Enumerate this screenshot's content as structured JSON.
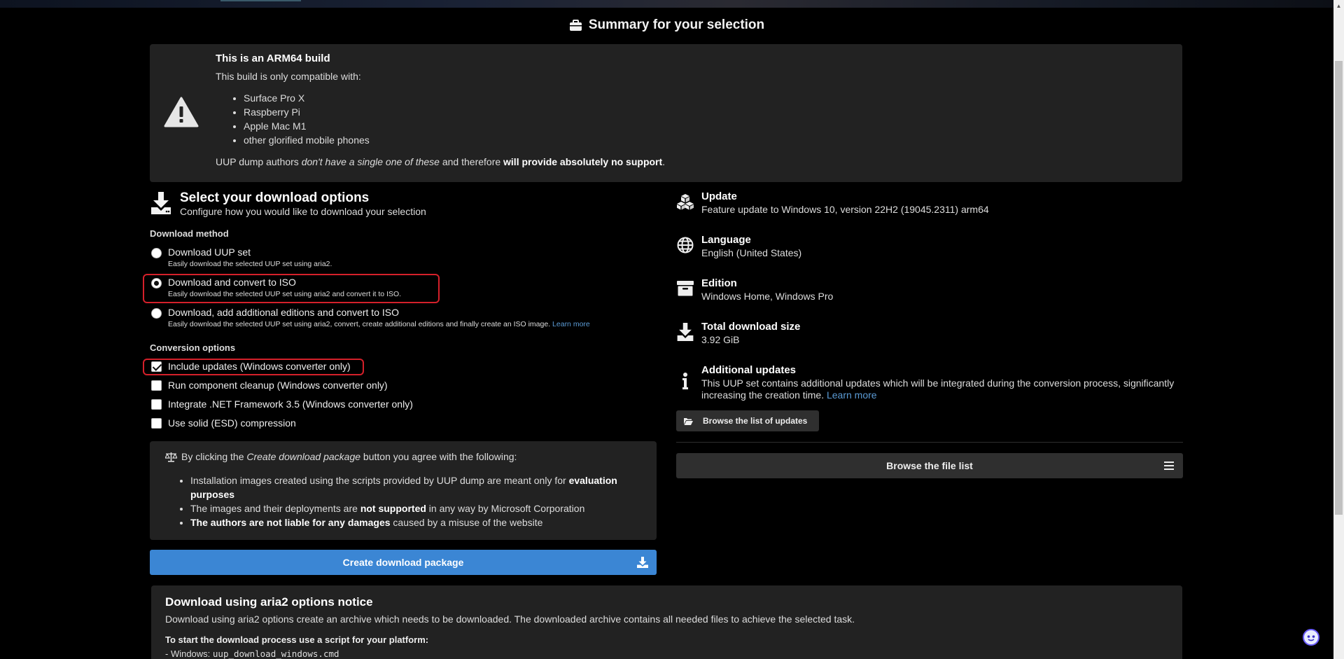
{
  "heading": "Summary for your selection",
  "warning": {
    "title": "This is an ARM64 build",
    "compat_label": "This build is only compatible with:",
    "devices": [
      "Surface Pro X",
      "Raspberry Pi",
      "Apple Mac M1",
      "other glorified mobile phones"
    ],
    "disclaimer_a": "UUP dump authors ",
    "disclaimer_b": "don't have a single one of these",
    "disclaimer_c": " and therefore ",
    "disclaimer_d": "will provide absolutely no support",
    "disclaimer_e": "."
  },
  "options": {
    "title": "Select your download options",
    "subtitle": "Configure how you would like to download your selection",
    "method_label": "Download method",
    "methods": [
      {
        "label": "Download UUP set",
        "desc": "Easily download the selected UUP set using aria2.",
        "checked": false
      },
      {
        "label": "Download and convert to ISO",
        "desc": "Easily download the selected UUP set using aria2 and convert it to ISO.",
        "checked": true
      },
      {
        "label": "Download, add additional editions and convert to ISO",
        "desc": "Easily download the selected UUP set using aria2, convert, create additional editions and finally create an ISO image.",
        "link": "Learn more",
        "checked": false
      }
    ],
    "conversion_label": "Conversion options",
    "conversions": [
      {
        "label": "Include updates (Windows converter only)",
        "checked": true
      },
      {
        "label": "Run component cleanup (Windows converter only)",
        "checked": false
      },
      {
        "label": "Integrate .NET Framework 3.5 (Windows converter only)",
        "checked": false
      },
      {
        "label": "Use solid (ESD) compression",
        "checked": false
      }
    ]
  },
  "agreement": {
    "lead_a": "By clicking the ",
    "lead_b": "Create download package",
    "lead_c": " button you agree with the following:",
    "items": [
      {
        "a": "Installation images created using the scripts provided by UUP dump are meant only for ",
        "b": "evaluation purposes",
        "c": ""
      },
      {
        "a": "The images and their deployments are ",
        "b": "not supported",
        "c": " in any way by Microsoft Corporation"
      },
      {
        "a": "",
        "b": "The authors are not liable for any damages",
        "c": " caused by a misuse of the website"
      }
    ]
  },
  "create_button": "Create download package",
  "summary": {
    "update": {
      "key": "Update",
      "value": "Feature update to Windows 10, version 22H2 (19045.2311) arm64"
    },
    "language": {
      "key": "Language",
      "value": "English (United States)"
    },
    "edition": {
      "key": "Edition",
      "value": "Windows Home, Windows Pro"
    },
    "size": {
      "key": "Total download size",
      "value": "3.92 GiB"
    },
    "additional": {
      "key": "Additional updates",
      "value": "This UUP set contains additional updates which will be integrated during the conversion process, significantly increasing the creation time.",
      "link": "Learn more"
    }
  },
  "browse_updates": "Browse the list of updates",
  "browse_files": "Browse the file list",
  "aria": {
    "title": "Download using aria2 options notice",
    "para": "Download using aria2 options create an archive which needs to be downloaded. The downloaded archive contains all needed files to achieve the selected task.",
    "start": "To start the download process use a script for your platform:",
    "win_prefix": "- Windows: ",
    "win_script": "uup_download_windows.cmd"
  },
  "colors": {
    "accent": "#3b86d4",
    "highlight": "#d4202a",
    "link": "#5b9bd5",
    "panel": "#222222"
  }
}
